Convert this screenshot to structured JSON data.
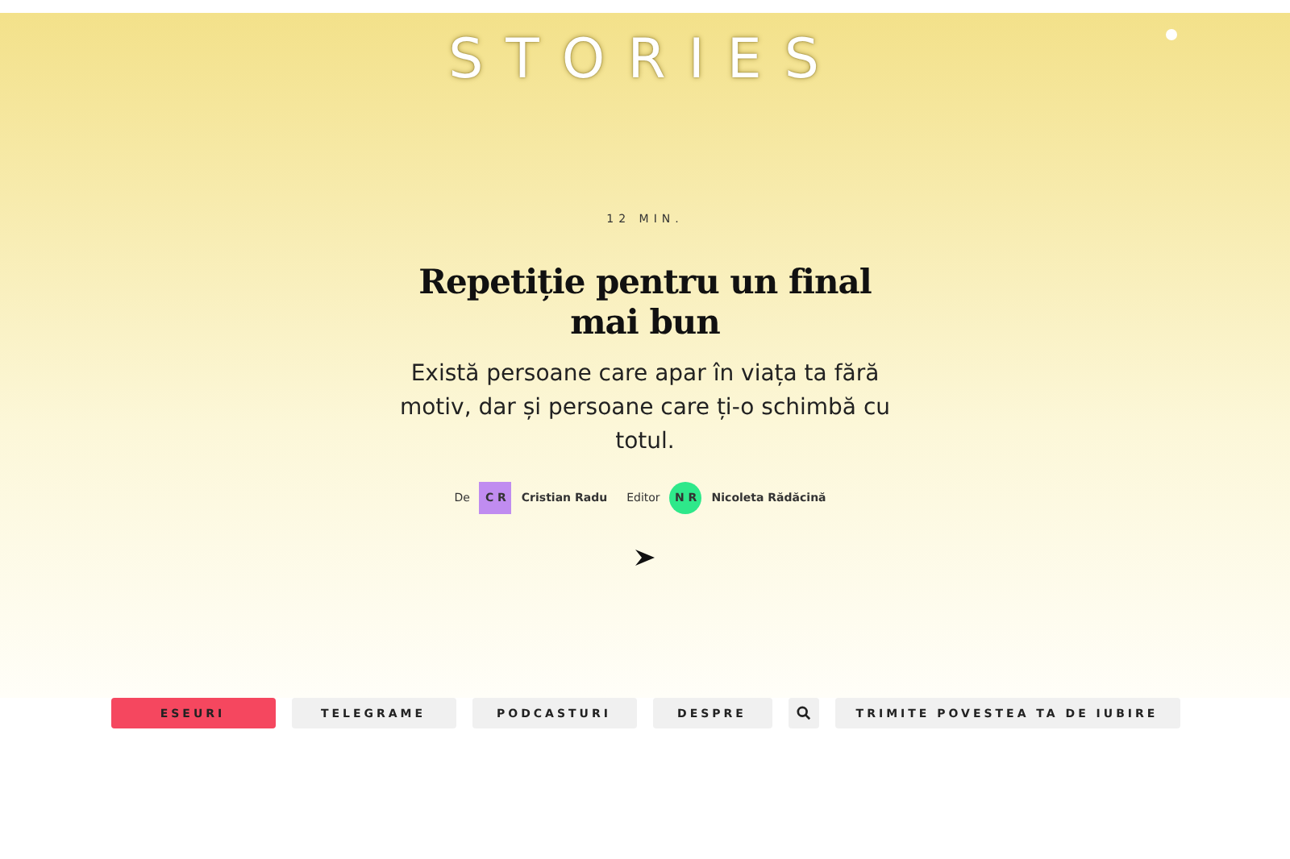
{
  "logo": "STORIES",
  "hero": {
    "duration": "12 MIN.",
    "title": "Repetiție pentru un final mai bun",
    "summary": "Există persoane care apar în viața ta fără motiv, dar și persoane care ți-o schimbă cu totul.",
    "byline": [
      {
        "label": "De",
        "initials": "C R",
        "name": "Cristian Radu",
        "color": "#c08cf0",
        "kind": "square"
      },
      {
        "label": "Editor",
        "initials": "N R",
        "name": "Nicoleta Rădăcină",
        "color": "#2ee88a",
        "kind": "circle"
      }
    ]
  },
  "nav": [
    {
      "kind": "text",
      "label": "ESEURI",
      "selected": true
    },
    {
      "kind": "text",
      "label": "TELEGRAME",
      "selected": false
    },
    {
      "kind": "text",
      "label": "PODCASTURI",
      "selected": false
    },
    {
      "kind": "text",
      "label": "DESPRE",
      "selected": false
    },
    {
      "kind": "search",
      "selected": false
    },
    {
      "kind": "text",
      "label": "TRIMITE POVESTEA TA DE IUBIRE",
      "selected": false
    }
  ]
}
